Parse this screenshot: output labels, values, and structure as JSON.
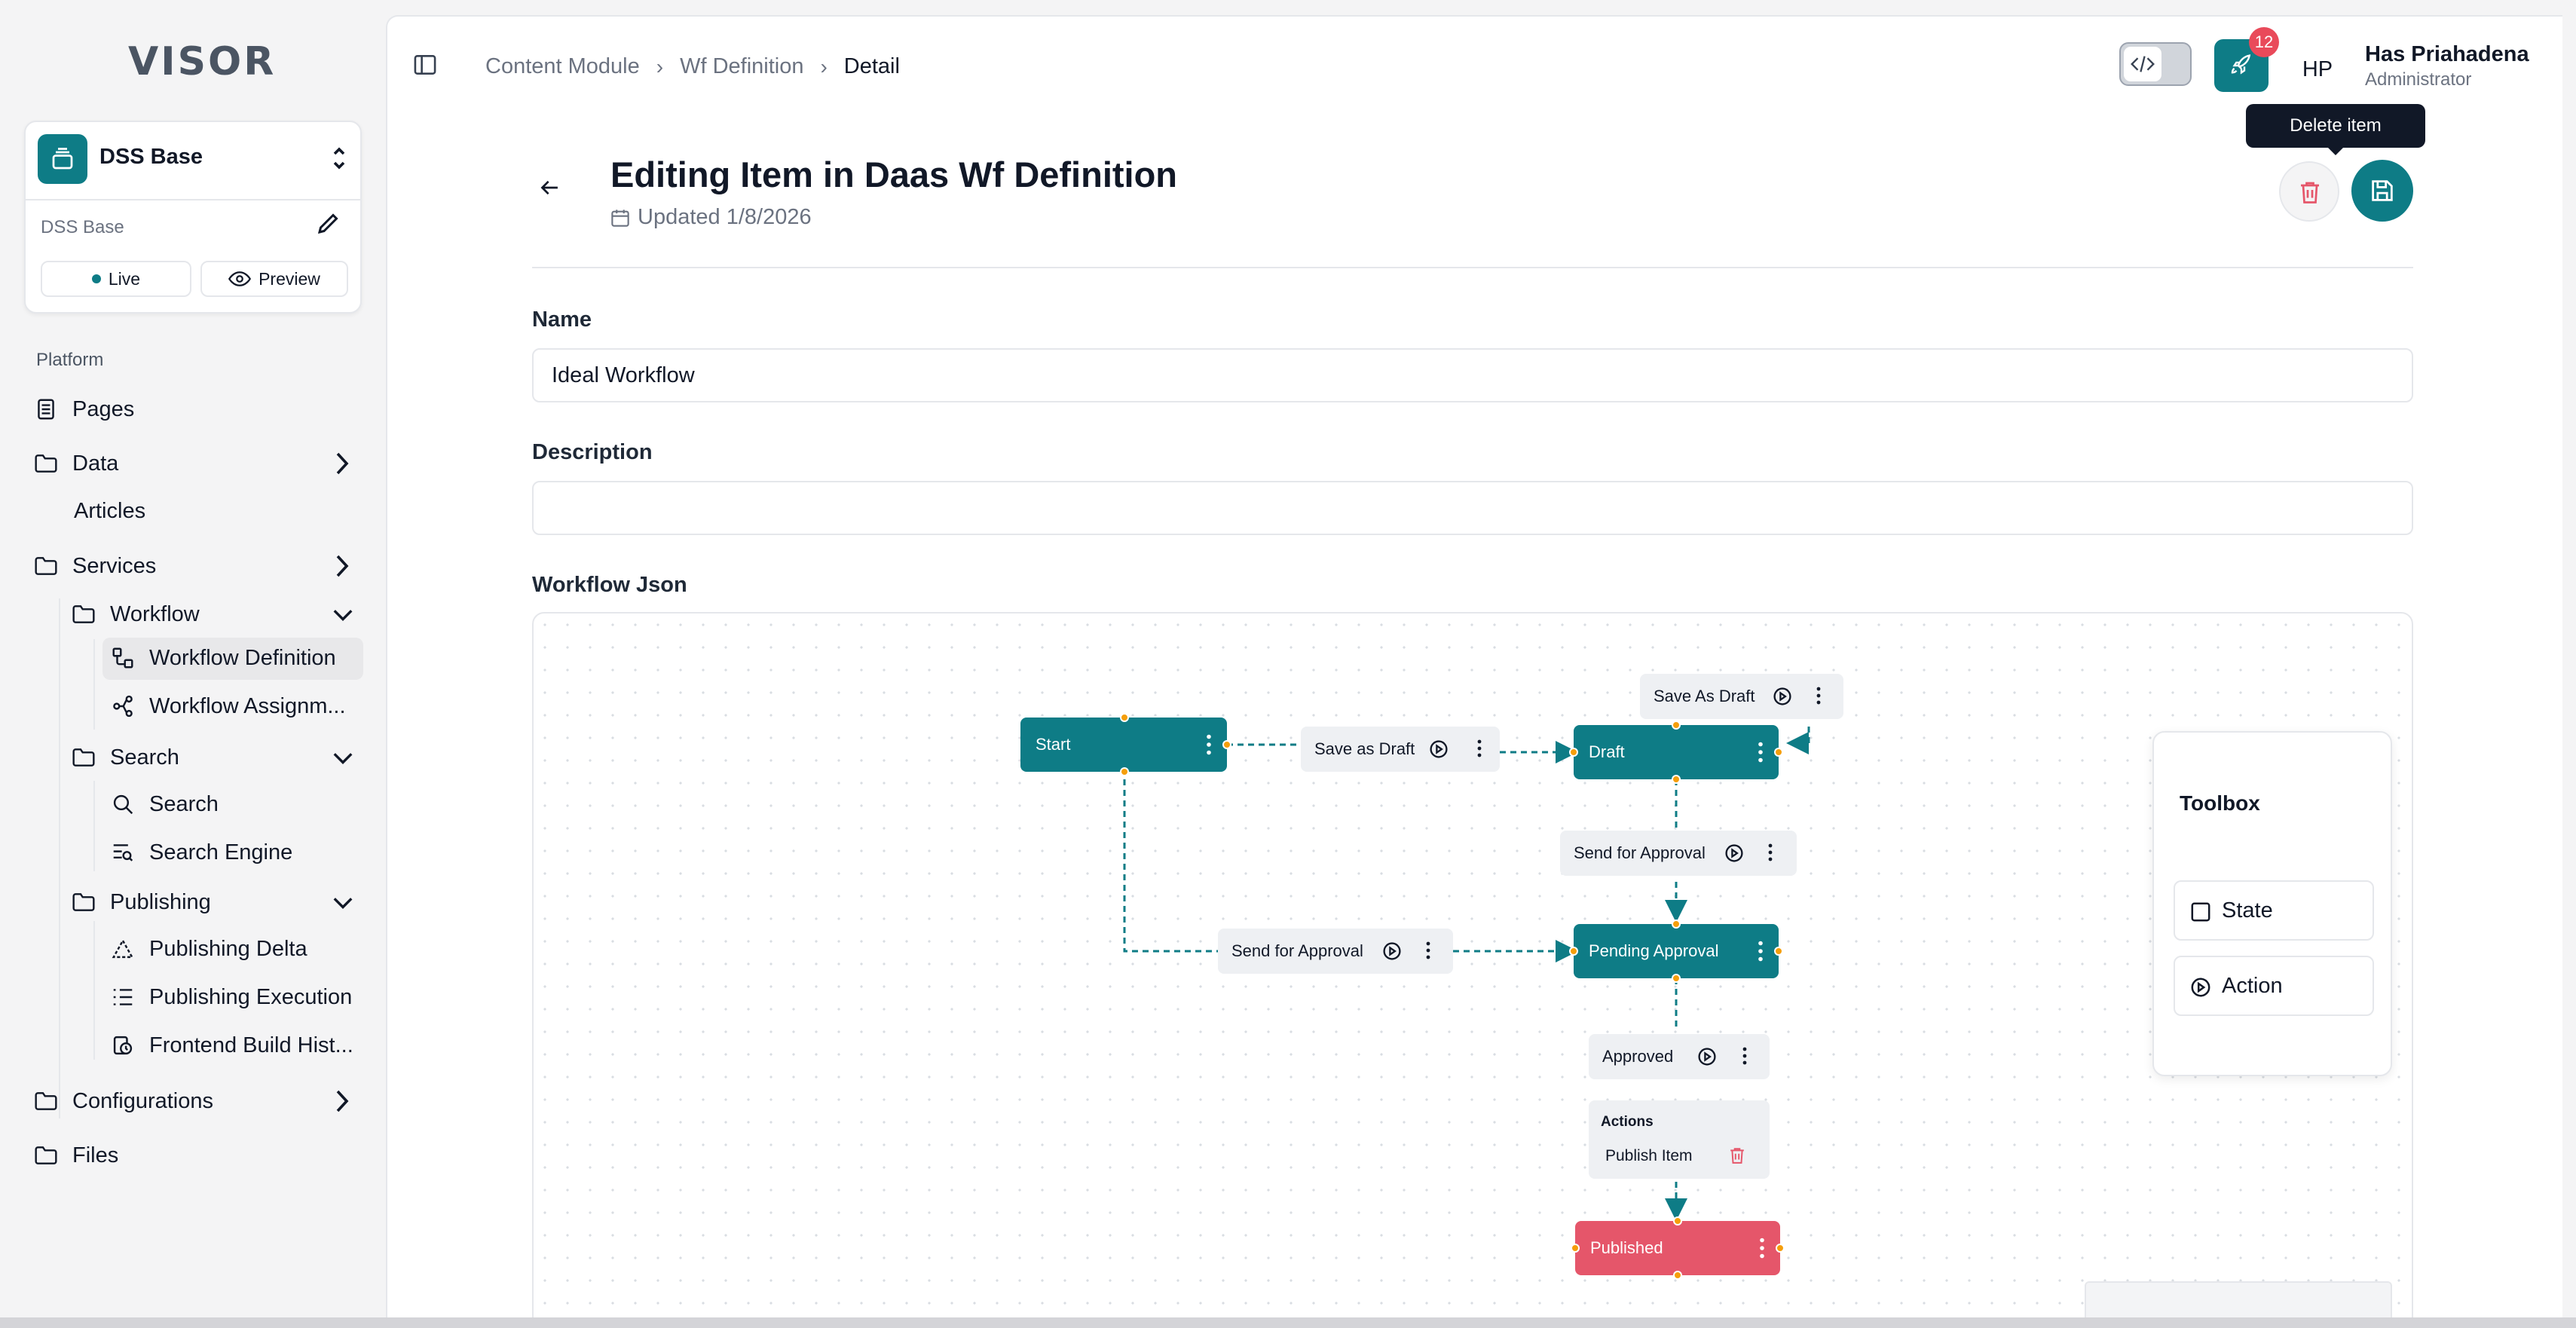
{
  "app": {
    "logo": "VISOR"
  },
  "workspace": {
    "name": "DSS Base",
    "subtitle": "DSS Base",
    "live_label": "Live",
    "preview_label": "Preview"
  },
  "sidebar": {
    "section": "Platform",
    "items": {
      "pages": "Pages",
      "data": "Data",
      "articles": "Articles",
      "services": "Services",
      "workflow": "Workflow",
      "workflow_definition": "Workflow Definition",
      "workflow_assignment": "Workflow Assignm...",
      "search_group": "Search",
      "search": "Search",
      "search_engine": "Search Engine",
      "publishing": "Publishing",
      "publishing_delta": "Publishing Delta",
      "publishing_execution": "Publishing Execution",
      "frontend_build": "Frontend Build Hist...",
      "configurations": "Configurations",
      "files": "Files"
    }
  },
  "header": {
    "breadcrumb": [
      "Content Module",
      "Wf Definition",
      "Detail"
    ],
    "notification_count": "12",
    "user": {
      "initials": "HP",
      "name": "Has Priahadena",
      "role": "Administrator"
    },
    "tooltip": "Delete item"
  },
  "page": {
    "title": "Editing Item in Daas Wf Definition",
    "updated": "Updated 1/8/2026"
  },
  "form": {
    "name_label": "Name",
    "name_value": "Ideal Workflow",
    "description_label": "Description",
    "description_value": "",
    "json_label": "Workflow Json"
  },
  "workflow": {
    "states": {
      "start": "Start",
      "draft": "Draft",
      "pending": "Pending Approval",
      "published": "Published"
    },
    "actions": {
      "save_as_draft": "Save as Draft",
      "save_as_draft_self": "Save As Draft",
      "send_for_approval_draft": "Send for Approval",
      "send_for_approval_start": "Send for Approval",
      "approved": "Approved"
    },
    "approved_actions": {
      "heading": "Actions",
      "item": "Publish Item"
    }
  },
  "toolbox": {
    "title": "Toolbox",
    "items": [
      "State",
      "Action"
    ]
  },
  "colors": {
    "primary": "#0e7c86",
    "danger": "#e5566a",
    "handle": "#f59e0b"
  }
}
